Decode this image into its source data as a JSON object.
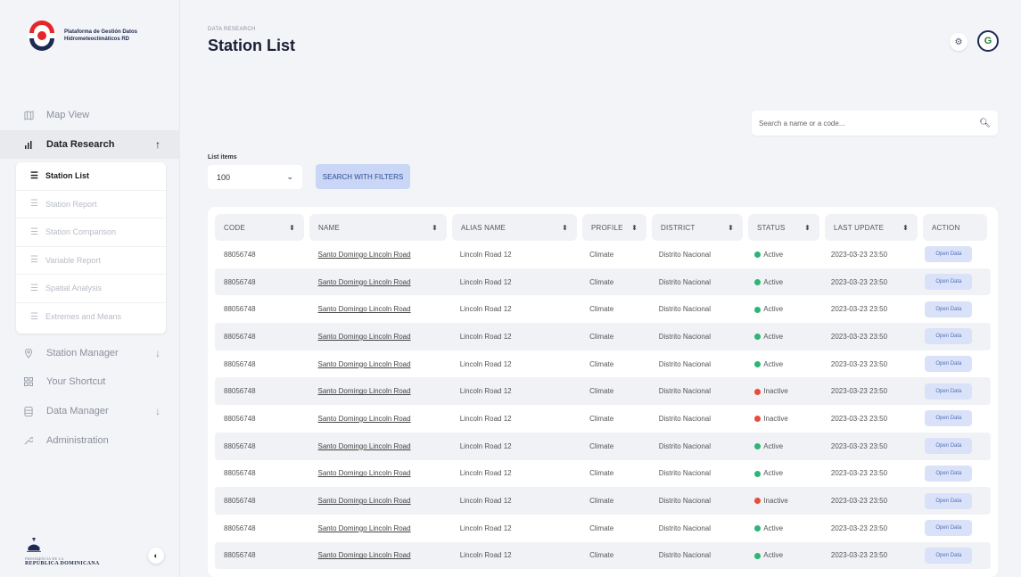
{
  "app": {
    "name": "Plataforma de Gestión Datos Hidrometeoclimáticos RD"
  },
  "sidebar": {
    "items": [
      {
        "label": "Map View",
        "icon": "map-icon"
      },
      {
        "label": "Data Research",
        "icon": "bar-chart-icon",
        "expanded": true
      },
      {
        "label": "Station Manager",
        "icon": "location-pin-icon"
      },
      {
        "label": "Your Shortcut",
        "icon": "grid-icon"
      },
      {
        "label": "Data Manager",
        "icon": "database-icon"
      },
      {
        "label": "Administration",
        "icon": "wrench-icon"
      }
    ],
    "subitems": [
      {
        "label": "Station List",
        "active": true
      },
      {
        "label": "Station Report"
      },
      {
        "label": "Station Comparison"
      },
      {
        "label": "Variable Report"
      },
      {
        "label": "Spatial Analysis"
      },
      {
        "label": "Extremes and Means"
      }
    ],
    "footer": {
      "gov_small": "PRESIDENCIA DE LA",
      "gov_big": "REPÚBLICA DOMINICANA"
    }
  },
  "header": {
    "breadcrumb": "DATA RESEARCH",
    "title": "Station List"
  },
  "search": {
    "placeholder": "Search a name or a code..."
  },
  "filters": {
    "list_label": "List items",
    "list_value": "100",
    "button_label": "SEARCH WITH FILTERS"
  },
  "colors": {
    "active": "#2bb673",
    "inactive": "#e74c3c",
    "accent": "#c9d6f5"
  },
  "table": {
    "columns": [
      "CODE",
      "NAME",
      "ALIAS NAME",
      "PROFILE",
      "DISTRICT",
      "STATUS",
      "LAST UPDATE",
      "ACTION"
    ],
    "rows": [
      {
        "code": "88056748",
        "name": "Santo Domingo Lincoln Road",
        "alias": "Lincoln Road 12",
        "profile": "Climate",
        "district": "Distrito Nacional",
        "status": "Active",
        "updated": "2023-03-23 23:50",
        "action": "Open Data"
      },
      {
        "code": "88056748",
        "name": "Santo Domingo Lincoln Road",
        "alias": "Lincoln Road 12",
        "profile": "Climate",
        "district": "Distrito Nacional",
        "status": "Active",
        "updated": "2023-03-23 23:50",
        "action": "Open Data"
      },
      {
        "code": "88056748",
        "name": "Santo Domingo Lincoln Road",
        "alias": "Lincoln Road 12",
        "profile": "Climate",
        "district": "Distrito Nacional",
        "status": "Active",
        "updated": "2023-03-23 23:50",
        "action": "Open Data"
      },
      {
        "code": "88056748",
        "name": "Santo Domingo Lincoln Road",
        "alias": "Lincoln Road 12",
        "profile": "Climate",
        "district": "Distrito Nacional",
        "status": "Active",
        "updated": "2023-03-23 23:50",
        "action": "Open Data"
      },
      {
        "code": "88056748",
        "name": "Santo Domingo Lincoln Road",
        "alias": "Lincoln Road 12",
        "profile": "Climate",
        "district": "Distrito Nacional",
        "status": "Active",
        "updated": "2023-03-23 23:50",
        "action": "Open Data"
      },
      {
        "code": "88056748",
        "name": "Santo Domingo Lincoln Road",
        "alias": "Lincoln Road 12",
        "profile": "Climate",
        "district": "Distrito Nacional",
        "status": "Inactive",
        "updated": "2023-03-23 23:50",
        "action": "Open Data"
      },
      {
        "code": "88056748",
        "name": "Santo Domingo Lincoln Road",
        "alias": "Lincoln Road 12",
        "profile": "Climate",
        "district": "Distrito Nacional",
        "status": "Inactive",
        "updated": "2023-03-23 23:50",
        "action": "Open Data"
      },
      {
        "code": "88056748",
        "name": "Santo Domingo Lincoln Road",
        "alias": "Lincoln Road 12",
        "profile": "Climate",
        "district": "Distrito Nacional",
        "status": "Active",
        "updated": "2023-03-23 23:50",
        "action": "Open Data"
      },
      {
        "code": "88056748",
        "name": "Santo Domingo Lincoln Road",
        "alias": "Lincoln Road 12",
        "profile": "Climate",
        "district": "Distrito Nacional",
        "status": "Active",
        "updated": "2023-03-23 23:50",
        "action": "Open Data"
      },
      {
        "code": "88056748",
        "name": "Santo Domingo Lincoln Road",
        "alias": "Lincoln Road 12",
        "profile": "Climate",
        "district": "Distrito Nacional",
        "status": "Inactive",
        "updated": "2023-03-23 23:50",
        "action": "Open Data"
      },
      {
        "code": "88056748",
        "name": "Santo Domingo Lincoln Road",
        "alias": "Lincoln Road 12",
        "profile": "Climate",
        "district": "Distrito Nacional",
        "status": "Active",
        "updated": "2023-03-23 23:50",
        "action": "Open Data"
      },
      {
        "code": "88056748",
        "name": "Santo Domingo Lincoln Road",
        "alias": "Lincoln Road 12",
        "profile": "Climate",
        "district": "Distrito Nacional",
        "status": "Active",
        "updated": "2023-03-23 23:50",
        "action": "Open Data"
      }
    ]
  }
}
